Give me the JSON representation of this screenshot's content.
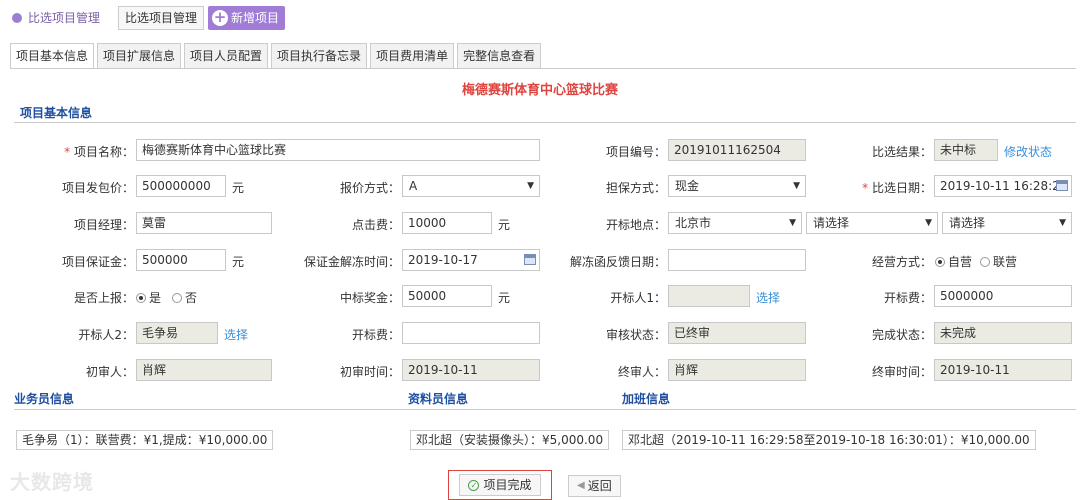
{
  "header": {
    "breadcrumb": "比选项目管理",
    "btn_manage": "比选项目管理",
    "btn_add": "新增项目"
  },
  "tabs": [
    "项目基本信息",
    "项目扩展信息",
    "项目人员配置",
    "项目执行备忘录",
    "项目费用清单",
    "完整信息查看"
  ],
  "page_title": "梅德赛斯体育中心篮球比赛",
  "sections": {
    "basic": "项目基本信息",
    "sales": "业务员信息",
    "material": "资料员信息",
    "overtime": "加班信息"
  },
  "form": {
    "project_name_label": "项目名称：",
    "project_name": "梅德赛斯体育中心篮球比赛",
    "project_no_label": "项目编号：",
    "project_no": "20191011162504",
    "result_label": "比选结果：",
    "result": "未中标",
    "modify_status": "修改状态",
    "contract_price_label": "项目发包价：",
    "contract_price": "500000000",
    "unit_yuan": "元",
    "quote_label": "报价方式：",
    "quote": "A",
    "guarantee_label": "担保方式：",
    "guarantee": "现金",
    "select_date_label": "比选日期：",
    "select_date": "2019-10-11 16:28:25",
    "manager_label": "项目经理：",
    "manager": "莫雷",
    "click_fee_label": "点击费：",
    "click_fee": "10000",
    "bid_place_label": "开标地点：",
    "bid_place_city": "北京市",
    "bid_place_sel2": "请选择",
    "bid_place_sel3": "请选择",
    "deposit_label": "项目保证金：",
    "deposit": "500000",
    "deposit_unfreeze_label": "保证金解冻时间：",
    "deposit_unfreeze": "2019-10-17",
    "unfreeze_feedback_label": "解冻函反馈日期：",
    "unfreeze_feedback": "",
    "operation_label": "经营方式：",
    "operation_opt1": "自营",
    "operation_opt2": "联营",
    "report_label": "是否上报：",
    "report_yes": "是",
    "report_no": "否",
    "bid_bonus_label": "中标奖金：",
    "bid_bonus": "50000",
    "bidder1_label": "开标人1：",
    "bidder1": "",
    "choose": "选择",
    "bid_fee_label": "开标费：",
    "bid_fee": "5000000",
    "bidder2_label": "开标人2：",
    "bidder2": "毛争易",
    "bid_fee2_label": "开标费：",
    "bid_fee2": "",
    "audit_status_label": "审核状态：",
    "audit_status": "已终审",
    "complete_status_label": "完成状态：",
    "complete_status": "未完成",
    "first_reviewer_label": "初审人：",
    "first_reviewer": "肖辉",
    "first_review_time_label": "初审时间：",
    "first_review_time": "2019-10-11",
    "final_reviewer_label": "终审人：",
    "final_reviewer": "肖辉",
    "final_review_time_label": "终审时间：",
    "final_review_time": "2019-10-11"
  },
  "info_chips": {
    "sales": "毛争易（1）：联营费：¥1,提成：¥10,000.00",
    "material": "邓北超（安装摄像头）：¥5,000.00",
    "overtime": "邓北超（2019-10-11 16:29:58至2019-10-18 16:30:01）：¥10,000.00"
  },
  "actions": {
    "complete": "项目完成",
    "back": "返回"
  },
  "watermark": "大数跨境"
}
